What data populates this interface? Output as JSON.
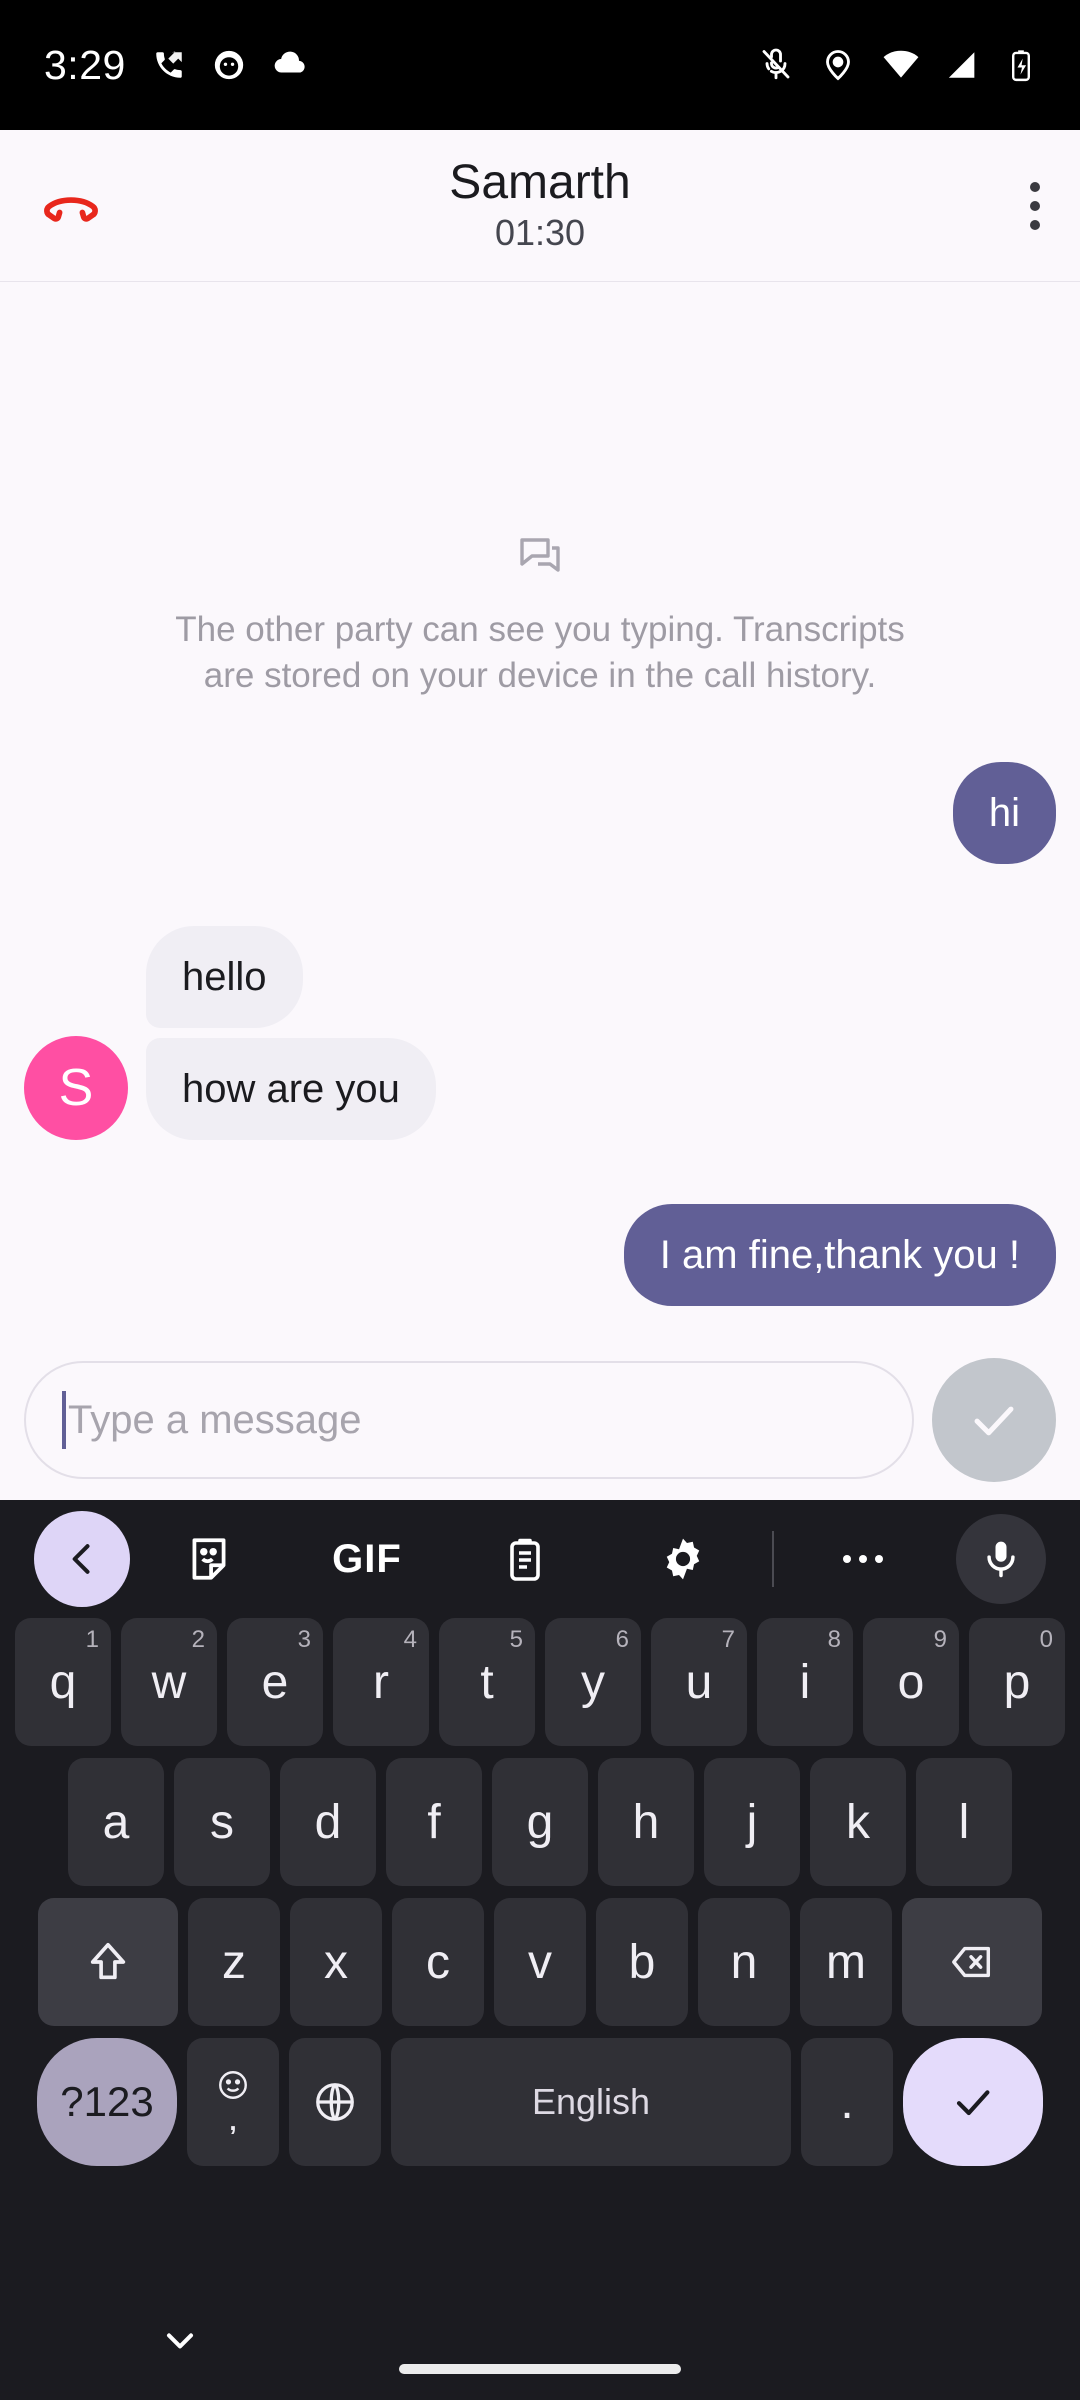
{
  "status_bar": {
    "time": "3:29",
    "left_icons": [
      "call-missed-icon",
      "app-notification-icon",
      "cloud-icon"
    ],
    "right_icons": [
      "mic-off-icon",
      "location-icon",
      "wifi-icon",
      "cellular-signal-icon",
      "battery-charging-icon"
    ],
    "background": "#000000"
  },
  "header": {
    "end_call_label": "end-call",
    "contact_name": "Samarth",
    "call_duration": "01:30",
    "overflow_label": "more-options",
    "background": "#fbf8fc"
  },
  "empty_state": {
    "icon": "chat-transcript-icon",
    "message": "The other party can see you typing. Transcripts are stored on your device in the call history."
  },
  "conversation": {
    "avatar_initial": "S",
    "avatar_color": "#ff4fa3",
    "outgoing_color": "#615f96",
    "incoming_color": "#f0eef4",
    "messages": [
      {
        "id": 0,
        "direction": "outgoing",
        "text": "hi"
      },
      {
        "id": 1,
        "direction": "incoming",
        "text": "hello"
      },
      {
        "id": 2,
        "direction": "incoming",
        "text": "how are you"
      },
      {
        "id": 3,
        "direction": "outgoing",
        "text": "I am fine,thank you !"
      }
    ]
  },
  "composer": {
    "placeholder": "Type a message",
    "value": "",
    "send_icon": "checkmark-icon",
    "send_button_color": "#c2c6cc"
  },
  "keyboard": {
    "toolbar": {
      "back_icon": "chevron-left-icon",
      "items": [
        "sticker-icon",
        "GIF",
        "clipboard-icon",
        "settings-gear-icon"
      ],
      "gif_label": "GIF",
      "more_icon": "more-horizontal-icon",
      "mic_icon": "microphone-icon"
    },
    "row1": [
      {
        "key": "q",
        "sup": "1"
      },
      {
        "key": "w",
        "sup": "2"
      },
      {
        "key": "e",
        "sup": "3"
      },
      {
        "key": "r",
        "sup": "4"
      },
      {
        "key": "t",
        "sup": "5"
      },
      {
        "key": "y",
        "sup": "6"
      },
      {
        "key": "u",
        "sup": "7"
      },
      {
        "key": "i",
        "sup": "8"
      },
      {
        "key": "o",
        "sup": "9"
      },
      {
        "key": "p",
        "sup": "0"
      }
    ],
    "row2": [
      "a",
      "s",
      "d",
      "f",
      "g",
      "h",
      "j",
      "k",
      "l"
    ],
    "row3": [
      "z",
      "x",
      "c",
      "v",
      "b",
      "n",
      "m"
    ],
    "shift_icon": "shift-arrow-icon",
    "backspace_icon": "backspace-icon",
    "row4": {
      "symbols_label": "?123",
      "emoji_icon": "emoji-smiley-icon",
      "comma_label": ",",
      "language_icon": "globe-icon",
      "space_label": "English",
      "period_label": ".",
      "enter_icon": "checkmark-icon"
    }
  },
  "nav_bar": {
    "hide_keyboard_icon": "chevron-down-icon",
    "home_indicator": "home-gesture-bar"
  }
}
